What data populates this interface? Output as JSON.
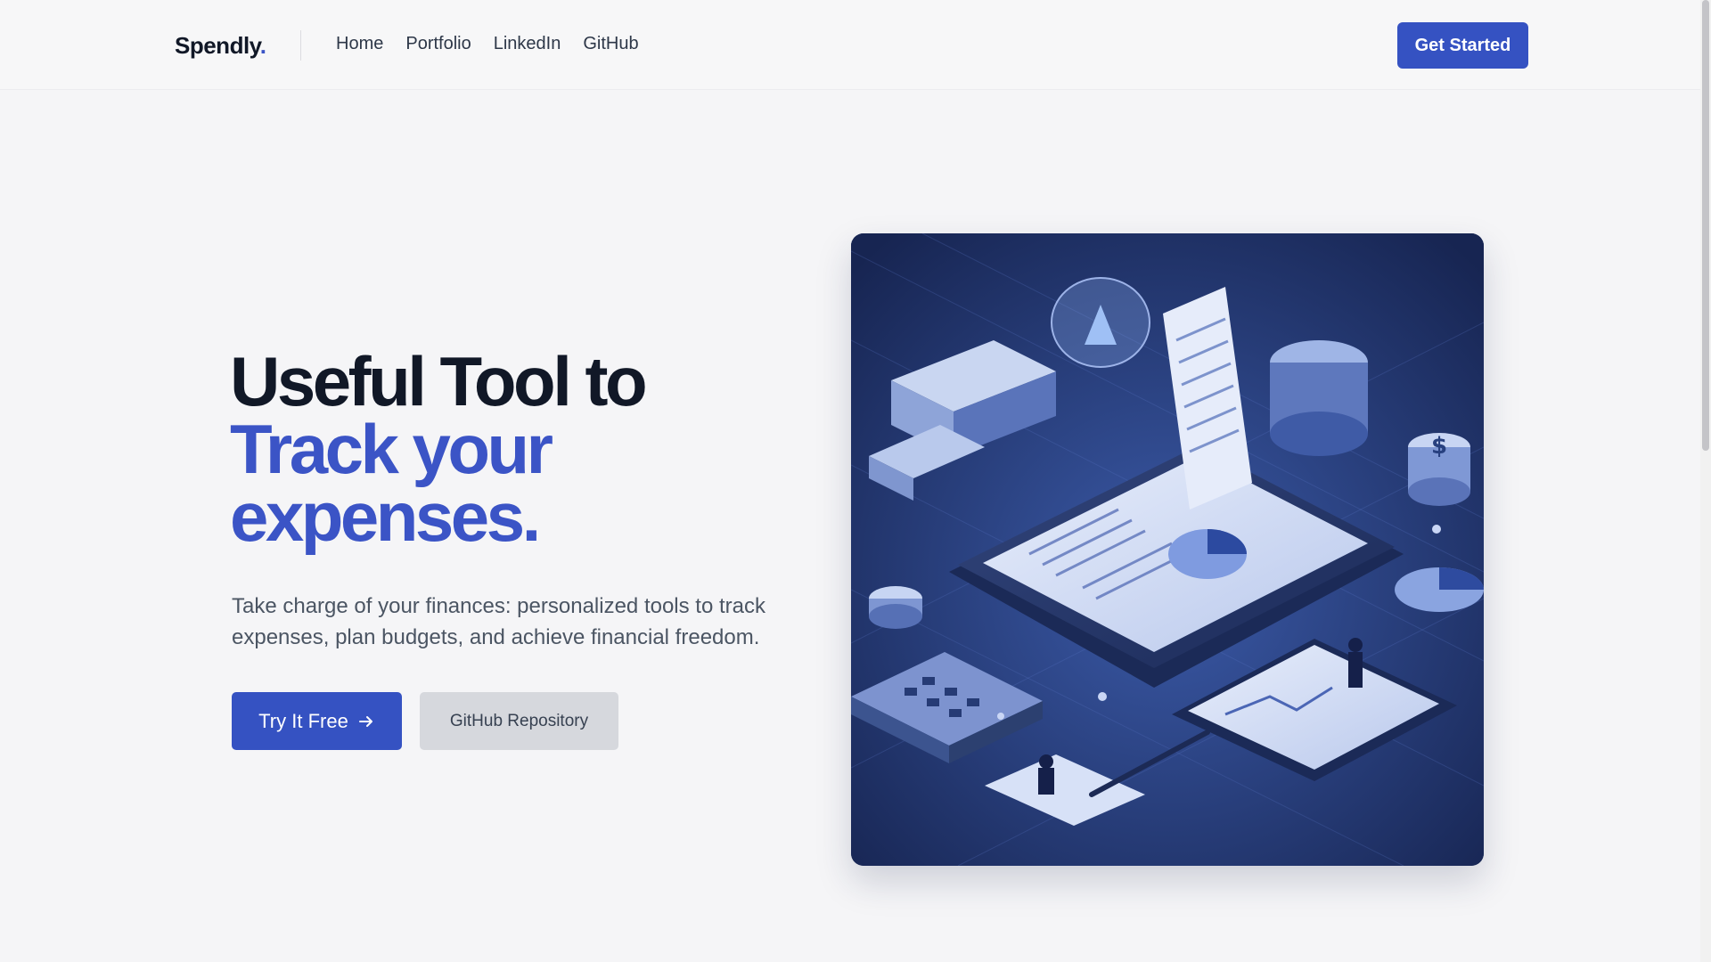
{
  "header": {
    "logo_text": "Spendly",
    "logo_dot": ".",
    "nav": [
      {
        "label": "Home"
      },
      {
        "label": "Portfolio"
      },
      {
        "label": "LinkedIn"
      },
      {
        "label": "GitHub"
      }
    ],
    "cta_label": "Get Started"
  },
  "hero": {
    "title_line1": "Useful Tool to",
    "title_line2": "Track your",
    "title_line3": "expenses.",
    "subtitle": "Take charge of your finances: personalized tools to track expenses, plan budgets, and achieve financial freedom.",
    "primary_button": "Try It Free",
    "secondary_button": "GitHub Repository"
  },
  "colors": {
    "accent": "#3552c2",
    "accent_text": "#3b54c6",
    "dark_text": "#111827"
  },
  "icons": {
    "primary_button_icon": "arrow-right-icon"
  }
}
